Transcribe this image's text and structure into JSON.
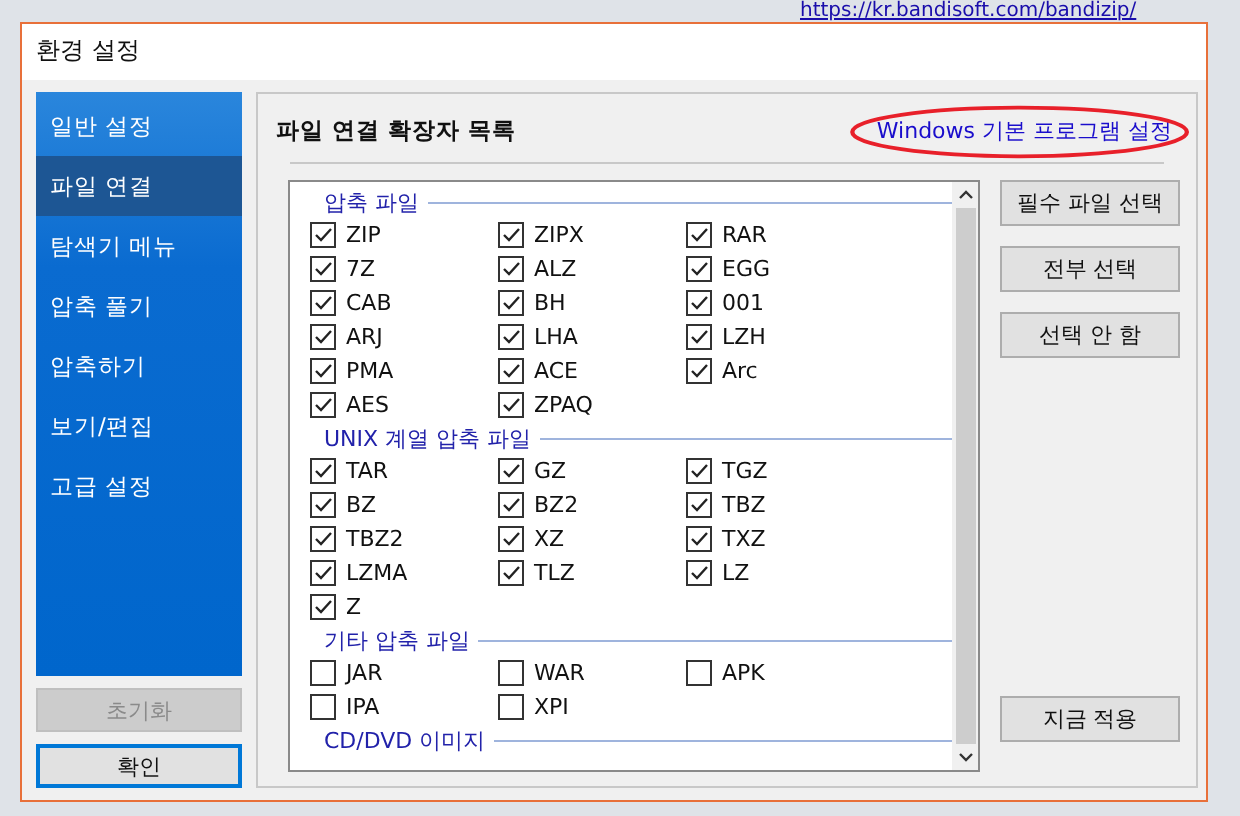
{
  "background": {
    "url": "https://kr.bandisoft.com/bandizip/"
  },
  "window": {
    "title": "환경 설정"
  },
  "sidebar": {
    "items": [
      {
        "label": "일반 설정",
        "selected": false
      },
      {
        "label": "파일 연결",
        "selected": true
      },
      {
        "label": "탐색기 메뉴",
        "selected": false
      },
      {
        "label": "압축 풀기",
        "selected": false
      },
      {
        "label": "압축하기",
        "selected": false
      },
      {
        "label": "보기/편집",
        "selected": false
      },
      {
        "label": "고급 설정",
        "selected": false
      }
    ],
    "buttons": [
      {
        "label": "초기화",
        "disabled": true
      },
      {
        "label": "확인",
        "disabled": false
      }
    ]
  },
  "panel": {
    "title": "파일 연결 확장자 목록",
    "link": {
      "text": "Windows 기본 프로그램 설정",
      "circled": true
    },
    "groups": [
      {
        "title": "압축 파일",
        "items": [
          {
            "label": "ZIP",
            "checked": true
          },
          {
            "label": "ZIPX",
            "checked": true
          },
          {
            "label": "RAR",
            "checked": true
          },
          {
            "label": "7Z",
            "checked": true
          },
          {
            "label": "ALZ",
            "checked": true
          },
          {
            "label": "EGG",
            "checked": true
          },
          {
            "label": "CAB",
            "checked": true
          },
          {
            "label": "BH",
            "checked": true
          },
          {
            "label": "001",
            "checked": true
          },
          {
            "label": "ARJ",
            "checked": true
          },
          {
            "label": "LHA",
            "checked": true
          },
          {
            "label": "LZH",
            "checked": true
          },
          {
            "label": "PMA",
            "checked": true
          },
          {
            "label": "ACE",
            "checked": true
          },
          {
            "label": "Arc",
            "checked": true
          },
          {
            "label": "AES",
            "checked": true
          },
          {
            "label": "ZPAQ",
            "checked": true
          }
        ]
      },
      {
        "title": "UNIX 계열 압축 파일",
        "items": [
          {
            "label": "TAR",
            "checked": true
          },
          {
            "label": "GZ",
            "checked": true
          },
          {
            "label": "TGZ",
            "checked": true
          },
          {
            "label": "BZ",
            "checked": true
          },
          {
            "label": "BZ2",
            "checked": true
          },
          {
            "label": "TBZ",
            "checked": true
          },
          {
            "label": "TBZ2",
            "checked": true
          },
          {
            "label": "XZ",
            "checked": true
          },
          {
            "label": "TXZ",
            "checked": true
          },
          {
            "label": "LZMA",
            "checked": true
          },
          {
            "label": "TLZ",
            "checked": true
          },
          {
            "label": "LZ",
            "checked": true
          },
          {
            "label": "Z",
            "checked": true
          }
        ]
      },
      {
        "title": "기타 압축 파일",
        "items": [
          {
            "label": "JAR",
            "checked": false
          },
          {
            "label": "WAR",
            "checked": false
          },
          {
            "label": "APK",
            "checked": false
          },
          {
            "label": "IPA",
            "checked": false
          },
          {
            "label": "XPI",
            "checked": false
          }
        ]
      },
      {
        "title": "CD/DVD 이미지"
      }
    ],
    "buttons": [
      "필수 파일 선택",
      "전부 선택",
      "선택 안 함"
    ],
    "apply_button": "지금 적용"
  }
}
